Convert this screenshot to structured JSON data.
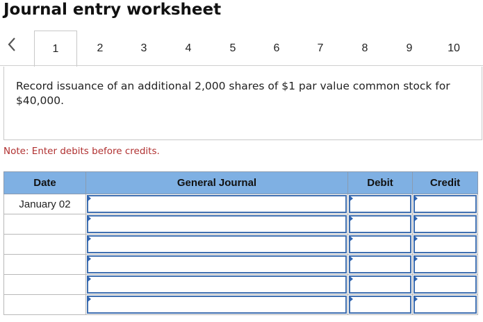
{
  "header": {
    "title": "Journal entry worksheet"
  },
  "tabs": {
    "prev_icon": "chevron-left-icon",
    "items": [
      {
        "label": "1",
        "active": true
      },
      {
        "label": "2"
      },
      {
        "label": "3"
      },
      {
        "label": "4"
      },
      {
        "label": "5"
      },
      {
        "label": "6"
      },
      {
        "label": "7"
      },
      {
        "label": "8"
      },
      {
        "label": "9"
      },
      {
        "label": "10"
      }
    ]
  },
  "instruction": "Record issuance of an additional 2,000 shares of $1 par value common stock for $40,000.",
  "note": "Note: Enter debits before credits.",
  "journal": {
    "columns": [
      "Date",
      "General Journal",
      "Debit",
      "Credit"
    ],
    "rows": [
      {
        "date": "January 02",
        "account": "",
        "debit": "",
        "credit": ""
      },
      {
        "date": "",
        "account": "",
        "debit": "",
        "credit": ""
      },
      {
        "date": "",
        "account": "",
        "debit": "",
        "credit": ""
      },
      {
        "date": "",
        "account": "",
        "debit": "",
        "credit": ""
      },
      {
        "date": "",
        "account": "",
        "debit": "",
        "credit": ""
      },
      {
        "date": "",
        "account": "",
        "debit": "",
        "credit": ""
      }
    ]
  },
  "colors": {
    "header_blue": "#7fb0e3",
    "input_border": "#3f6fb0",
    "note_red": "#b03030"
  }
}
